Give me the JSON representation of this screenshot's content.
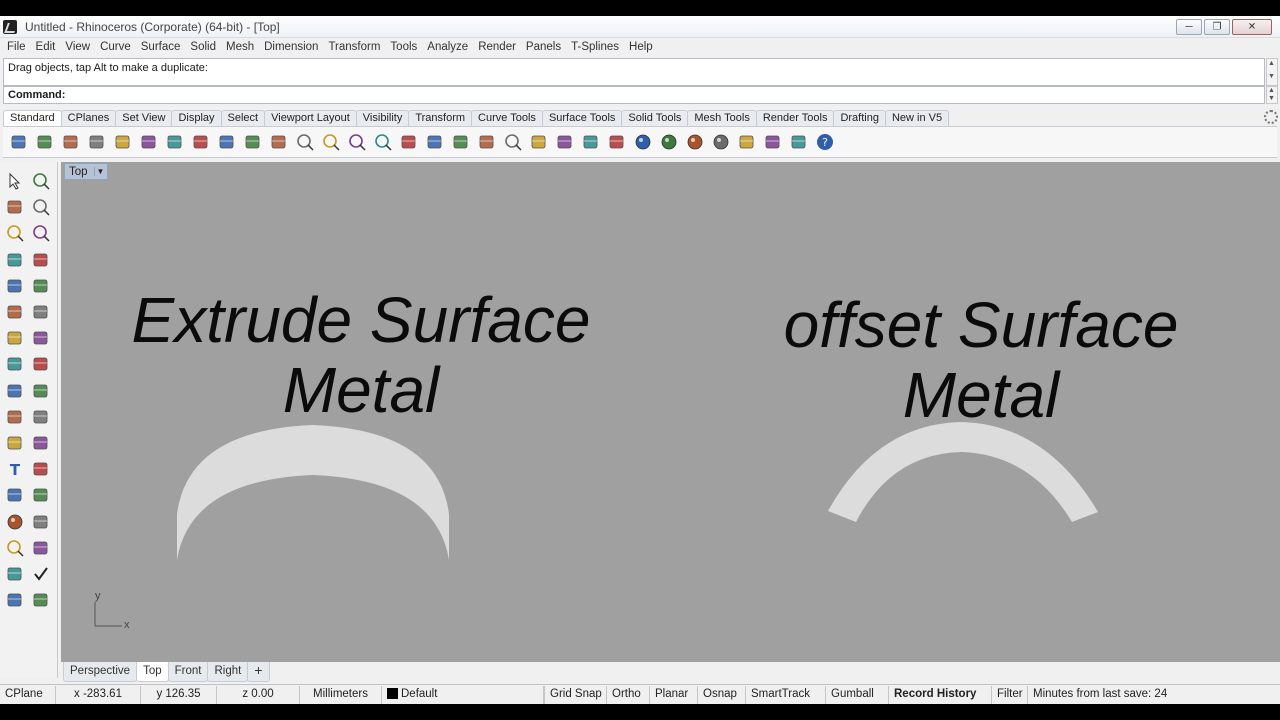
{
  "window": {
    "title": "Untitled - Rhinoceros (Corporate) (64-bit) - [Top]"
  },
  "menu": [
    "File",
    "Edit",
    "View",
    "Curve",
    "Surface",
    "Solid",
    "Mesh",
    "Dimension",
    "Transform",
    "Tools",
    "Analyze",
    "Render",
    "Panels",
    "T-Splines",
    "Help"
  ],
  "command": {
    "history": "Drag objects, tap Alt to make a duplicate:",
    "prompt": "Command:"
  },
  "toolbar_tabs": [
    "Standard",
    "CPlanes",
    "Set View",
    "Display",
    "Select",
    "Viewport Layout",
    "Visibility",
    "Transform",
    "Curve Tools",
    "Surface Tools",
    "Solid Tools",
    "Mesh Tools",
    "Render Tools",
    "Drafting",
    "New in V5"
  ],
  "toolbar_icons": [
    "new-file-icon",
    "open-folder-icon",
    "save-icon",
    "print-icon",
    "import-icon",
    "cut-icon",
    "copy-icon",
    "paste-icon",
    "undo-icon",
    "pan-hand-icon",
    "rotate-view-icon",
    "zoom-icon",
    "zoom-window-icon",
    "zoom-extents-icon",
    "zoom-selected-icon",
    "rotate-icon",
    "four-viewports-icon",
    "car-icon",
    "camera-icon",
    "ortho-circle-icon",
    "snap-icon",
    "lightbulb-icon",
    "lock-icon",
    "layer-icon",
    "color-wheel-icon",
    "shaded-sphere-icon",
    "rendered-sphere-icon",
    "render-icon",
    "bolt-icon",
    "gear-options-icon",
    "grid-icon",
    "help-icon"
  ],
  "left_tools": [
    [
      "select-arrow-icon",
      "point-icon"
    ],
    [
      "polyline-icon",
      "curve-points-icon"
    ],
    [
      "circle-icon",
      "ellipse-icon"
    ],
    [
      "polygon-icon",
      "rectangle-icon"
    ],
    [
      "hexagon-icon",
      "fillet-icon"
    ],
    [
      "offset-curve-icon",
      "extend-icon"
    ],
    [
      "surface-icon",
      "loft-icon"
    ],
    [
      "box-icon",
      "solid-icon"
    ],
    [
      "mesh-icon",
      "extrude-icon"
    ],
    [
      "boolean-icon",
      "split-icon"
    ],
    [
      "transform-icon",
      "array-icon"
    ],
    [
      "text-icon",
      "dimension-icon"
    ],
    [
      "block-icon",
      "history-icon"
    ],
    [
      "render-icon",
      "grid-lines-icon"
    ],
    [
      "points-grid-icon",
      "gumball-icon"
    ],
    [
      "layers-icon",
      "check-icon"
    ],
    [
      "analyze-icon",
      "paint-icon"
    ]
  ],
  "viewport": {
    "label": "Top",
    "texts": [
      {
        "line1": "Extrude Surface",
        "line2": "Metal"
      },
      {
        "line1": "offset Surface",
        "line2": "Metal"
      }
    ],
    "axis_x": "x",
    "axis_y": "y",
    "bg_color": "#a0a0a0",
    "shape_color": "#dcdcdc"
  },
  "viewport_tabs": [
    "Perspective",
    "Top",
    "Front",
    "Right"
  ],
  "statusbar": {
    "cplane": "CPlane",
    "x": "x -283.61",
    "y": "y 126.35",
    "z": "z 0.00",
    "units": "Millimeters",
    "layer": "Default",
    "grid_snap": "Grid Snap",
    "ortho": "Ortho",
    "planar": "Planar",
    "osnap": "Osnap",
    "smarttrack": "SmartTrack",
    "gumball": "Gumball",
    "record_history": "Record History",
    "filter": "Filter",
    "save_info": "Minutes from last save: 24"
  }
}
